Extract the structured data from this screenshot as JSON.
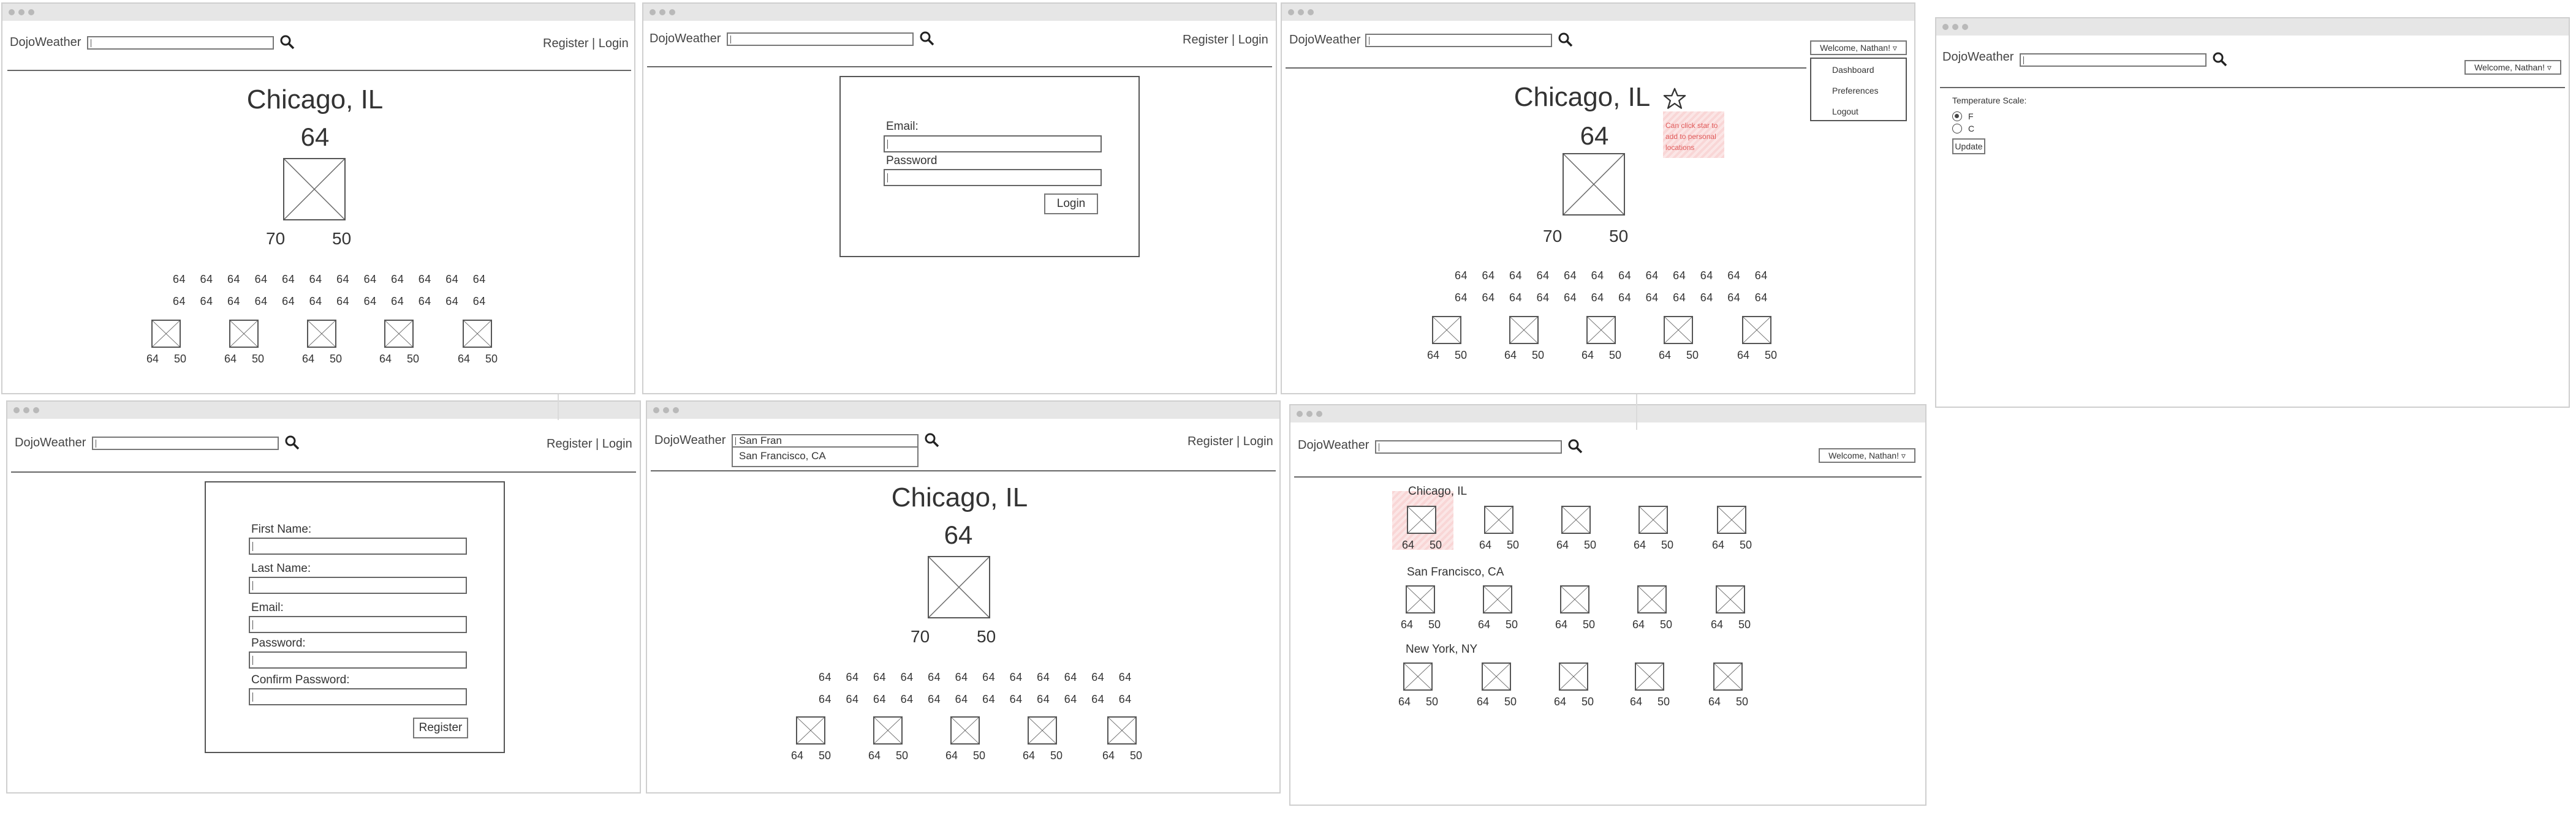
{
  "app_name": "DojoWeather",
  "auth_links": "Register | Login",
  "welcome_label": "Welcome, Nathan!",
  "home": {
    "city": "Chicago, IL",
    "current_temp": "64",
    "high": "70",
    "low": "50",
    "hourly_row_1": "64 64 64 64 64 64 64 64 64 64 64 64",
    "hourly_row_2": "64 64 64 64 64 64 64 64 64 64 64 64",
    "day_temps": "64 50"
  },
  "login": {
    "email_label": "Email:",
    "password_label": "Password",
    "button": "Login"
  },
  "register": {
    "first_name_label": "First Name:",
    "last_name_label": "Last Name:",
    "email_label": "Email:",
    "password_label": "Password:",
    "confirm_label": "Confirm Password:",
    "button": "Register"
  },
  "search": {
    "query": "San Fran",
    "suggestion": "San Francisco, CA"
  },
  "logged_in": {
    "dropdown_items": [
      "Dashboard",
      "Preferences",
      "Logout"
    ],
    "annotation": "Can click star to add to personal locations",
    "hourly_row_1": "64 64 64 64 64 64 64 64 64 64 64 64",
    "hourly_row_2": "64 64 64 64 64 64 64 64 64 64 64 64"
  },
  "preferences": {
    "scale_label": "Temperature Scale:",
    "option_f": "F",
    "option_c": "C",
    "button": "Update"
  },
  "dashboard": {
    "cities": [
      "Chicago, IL",
      "San Francisco, CA",
      "New York, NY"
    ]
  }
}
